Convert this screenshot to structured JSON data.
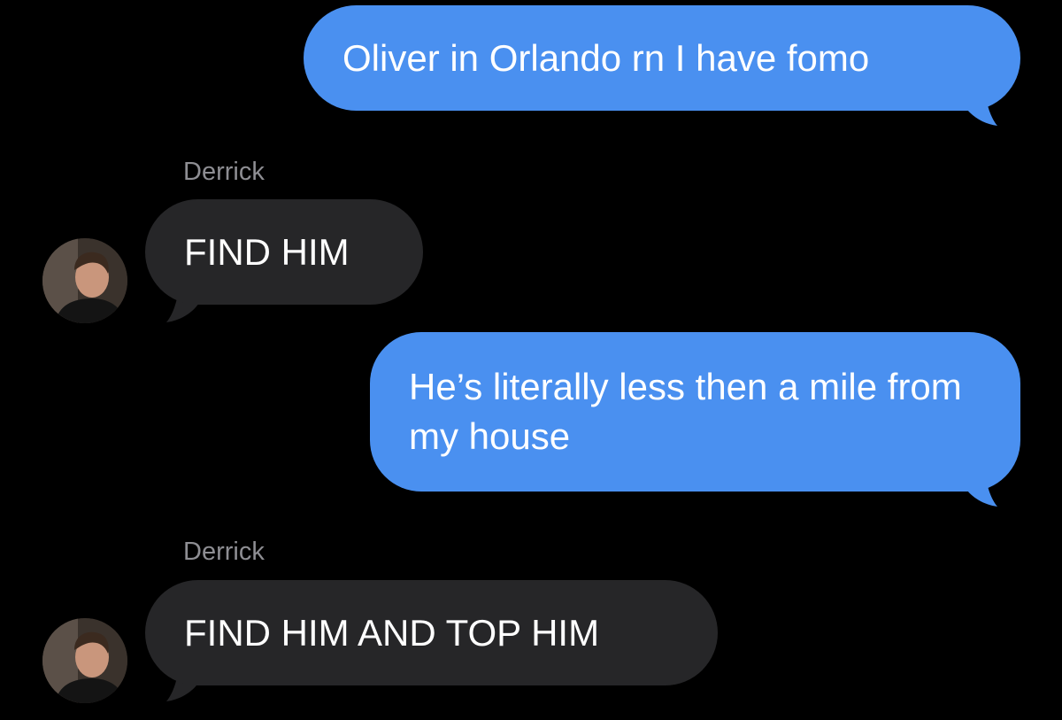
{
  "colors": {
    "background": "#000000",
    "outgoing_bubble": "#4a90f0",
    "incoming_bubble": "#262628",
    "message_text": "#ffffff",
    "sender_name": "#8e8e93"
  },
  "messages": [
    {
      "direction": "outgoing",
      "text": "Oliver in Orlando rn I have fomo"
    },
    {
      "direction": "incoming",
      "sender": "Derrick",
      "avatar_icon": "contact-photo-icon",
      "text": "FIND HIM"
    },
    {
      "direction": "outgoing",
      "text": "He’s literally less then a mile from my house"
    },
    {
      "direction": "incoming",
      "sender": "Derrick",
      "avatar_icon": "contact-photo-icon",
      "text": "FIND HIM AND TOP HIM"
    }
  ]
}
